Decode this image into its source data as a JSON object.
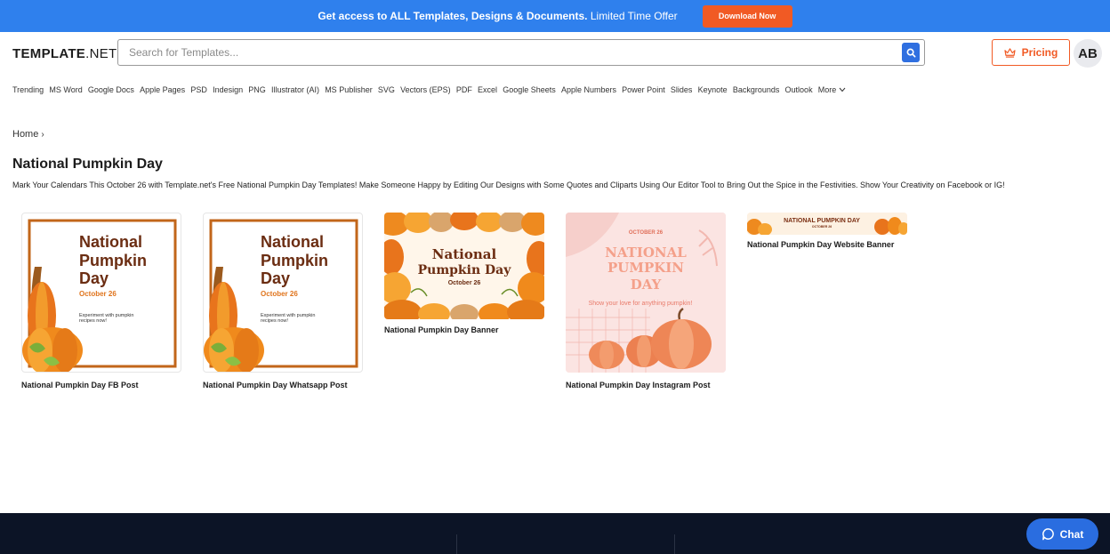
{
  "promo": {
    "bold_text": "Get access to ALL Templates, Designs & Documents.",
    "text": " Limited Time Offer",
    "button_label": "Download Now"
  },
  "header": {
    "logo_bold": "TEMPLATE",
    "logo_light": ".NET",
    "search_placeholder": "Search for Templates...",
    "pricing_label": "Pricing",
    "avatar_initials": "AB"
  },
  "nav": {
    "items": [
      "Trending",
      "MS Word",
      "Google Docs",
      "Apple Pages",
      "PSD",
      "Indesign",
      "PNG",
      "Illustrator (AI)",
      "MS Publisher",
      "SVG",
      "Vectors (EPS)",
      "PDF",
      "Excel",
      "Google Sheets",
      "Apple Numbers",
      "Power Point",
      "Slides",
      "Keynote",
      "Backgrounds",
      "Outlook"
    ],
    "more_label": "More"
  },
  "breadcrumb": {
    "home": "Home",
    "separator": "›"
  },
  "page": {
    "title": "National Pumpkin Day",
    "description": "Mark Your Calendars This October 26 with Template.net's Free National Pumpkin Day Templates! Make Someone Happy by Editing Our Designs with Some Quotes and Cliparts Using Our Editor Tool to Bring Out the Spice in the Festivities. Show Your Creativity on Facebook or IG!"
  },
  "cards": [
    {
      "label": "National Pumpkin Day FB Post",
      "thumb": {
        "line1": "National",
        "line2": "Pumpkin",
        "line3": "Day",
        "date": "October 26",
        "note1": "Experiment with pumpkin",
        "note2": "recipes now!"
      }
    },
    {
      "label": "National Pumpkin Day Whatsapp Post",
      "thumb": {
        "line1": "National",
        "line2": "Pumpkin",
        "line3": "Day",
        "date": "October 26",
        "note1": "Experiment with pumpkin",
        "note2": "recipes now!"
      }
    },
    {
      "label": "National Pumpkin Day Banner",
      "thumb": {
        "line1": "National",
        "line2": "Pumpkin Day",
        "date": "October 26"
      }
    },
    {
      "label": "National Pumpkin Day Instagram Post",
      "thumb": {
        "date": "OCTOBER 26",
        "line1": "NATIONAL",
        "line2": "PUMPKIN",
        "line3": "DAY",
        "note": "Show your love for anything pumpkin!"
      }
    },
    {
      "label": "National Pumpkin Day Website Banner",
      "thumb": {
        "title": "NATIONAL PUMPKIN DAY",
        "date": "OCTOBER 26"
      }
    }
  ],
  "chat": {
    "label": "Chat"
  },
  "colors": {
    "accent_blue": "#2f80ed",
    "brand_orange": "#f15a24",
    "footer_navy": "#0c1426",
    "pumpkin_orange": "#f08a1c",
    "title_brown": "#6b2d12"
  },
  "icons": [
    "search-icon",
    "crown-icon",
    "chevron-down-icon",
    "chat-bubble-icon"
  ]
}
